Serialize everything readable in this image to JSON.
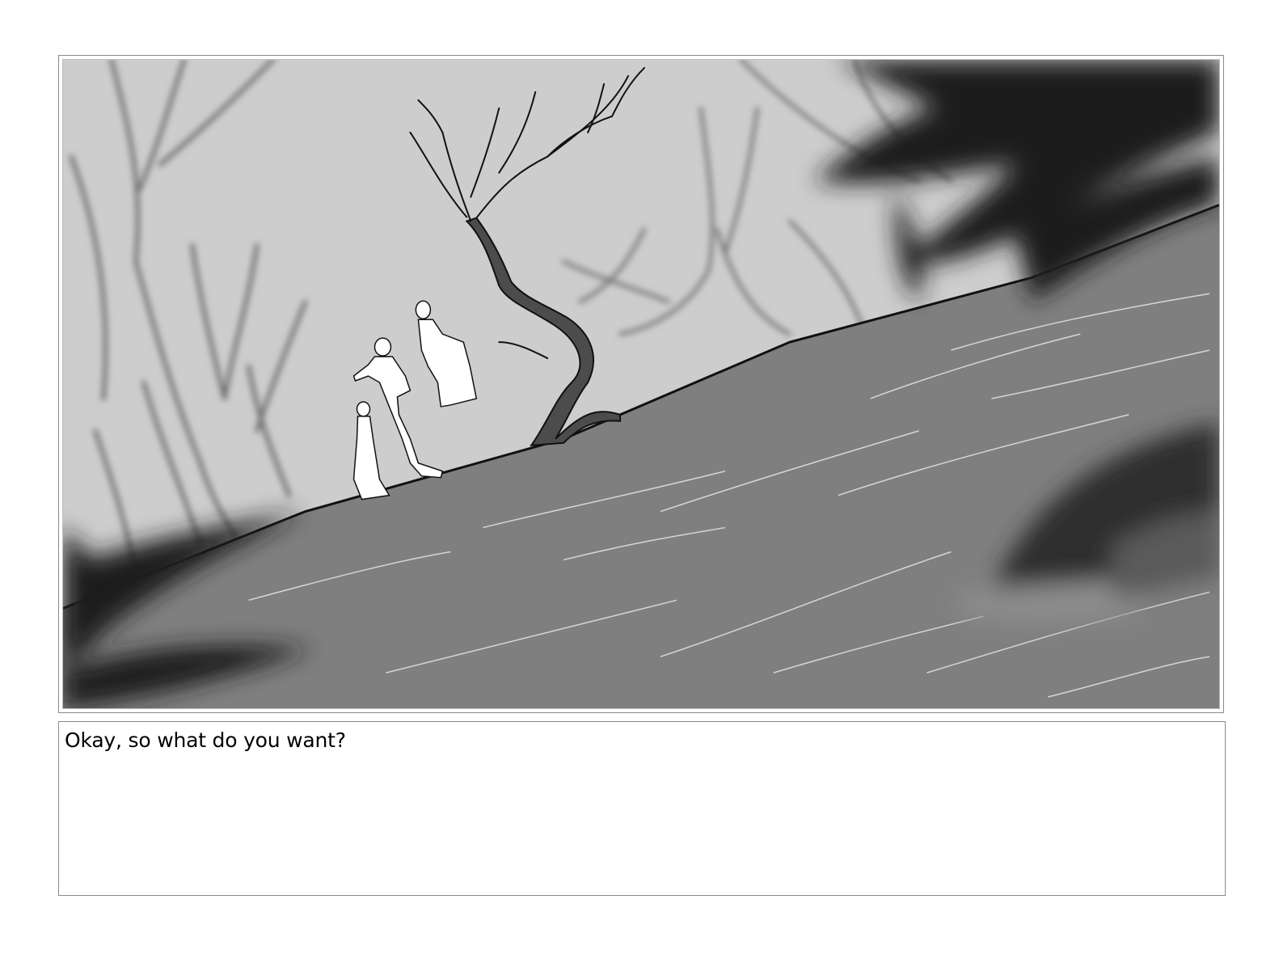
{
  "storyboard": {
    "panel": {
      "scene_icon": "storyboard-sketch-icon",
      "colors": {
        "sky": "#cdcdcd",
        "hill": "#7f7f7f",
        "foliage": "#1c1c1c",
        "figures": "#ffffff"
      }
    },
    "caption": {
      "text": "Okay, so what do you want?"
    }
  }
}
